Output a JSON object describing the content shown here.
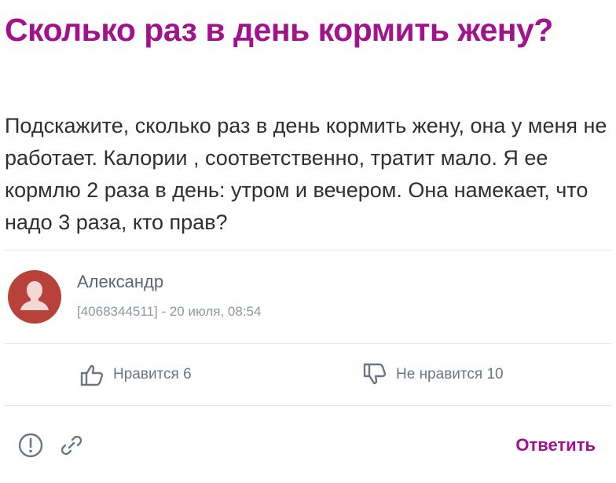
{
  "post": {
    "title": "Сколько раз в день кормить жену?",
    "question": "Подскажите, сколько раз в день кормить жену, она у меня не работает. Калории , соответственно, тратит мало. Я ее кормлю 2 раза в день: утром и вечером. Она намекает, что надо 3 раза, кто прав?"
  },
  "author": {
    "name": "Александр",
    "id": "[4068344511]",
    "separator": " - ",
    "datetime": "20 июля, 08:54"
  },
  "votes": {
    "like_label": "Нравится 6",
    "dislike_label": "Не нравится 10"
  },
  "actions": {
    "reply_label": "Ответить"
  },
  "icons": {
    "avatar": "user-silhouette-icon",
    "like": "thumbs-up-icon",
    "dislike": "thumbs-down-icon",
    "report": "exclamation-circle-icon",
    "link": "link-icon"
  },
  "colors": {
    "accent": "#a2128d",
    "avatar_bg": "#b8423a",
    "muted_text": "#8e98a0"
  }
}
